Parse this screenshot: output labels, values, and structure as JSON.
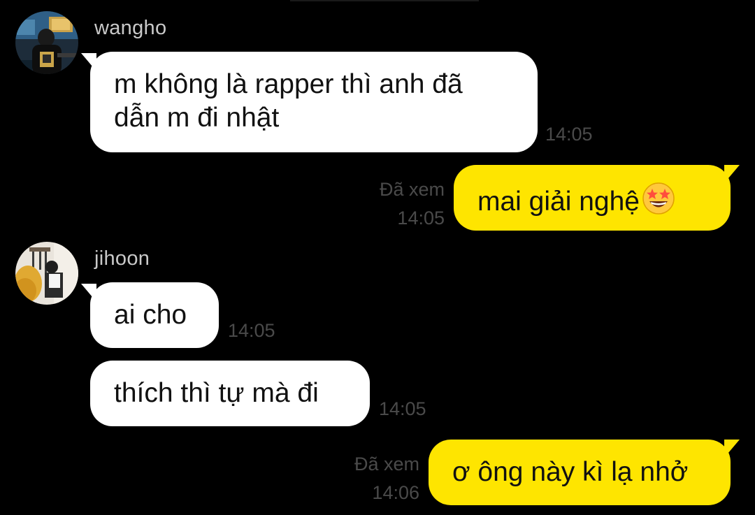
{
  "messages": [
    {
      "sender": "wangho",
      "text_line1": "m không là rapper thì anh đã",
      "text_line2": "dẫn m đi nhật",
      "time": "14:05"
    },
    {
      "sender": "me",
      "text": "mai giải nghệ",
      "emoji": "star-struck-emoji",
      "status": "Đã xem",
      "time": "14:05"
    },
    {
      "sender": "jihoon",
      "text": "ai cho",
      "time": "14:05"
    },
    {
      "sender": "jihoon",
      "text": "thích thì tự mà đi",
      "time": "14:05"
    },
    {
      "sender": "me",
      "text": "ơ ông này kì lạ nhở",
      "status": "Đã xem",
      "time": "14:06"
    }
  ],
  "contacts": {
    "wangho": {
      "name": "wangho",
      "avatar": "wangho-avatar-photo"
    },
    "jihoon": {
      "name": "jihoon",
      "avatar": "jihoon-avatar-photo"
    }
  },
  "colors": {
    "background": "#000000",
    "incoming_bubble": "#ffffff",
    "outgoing_bubble": "#fee500",
    "meta_text": "#4a4a4a",
    "name_text": "#c9c9c9"
  }
}
